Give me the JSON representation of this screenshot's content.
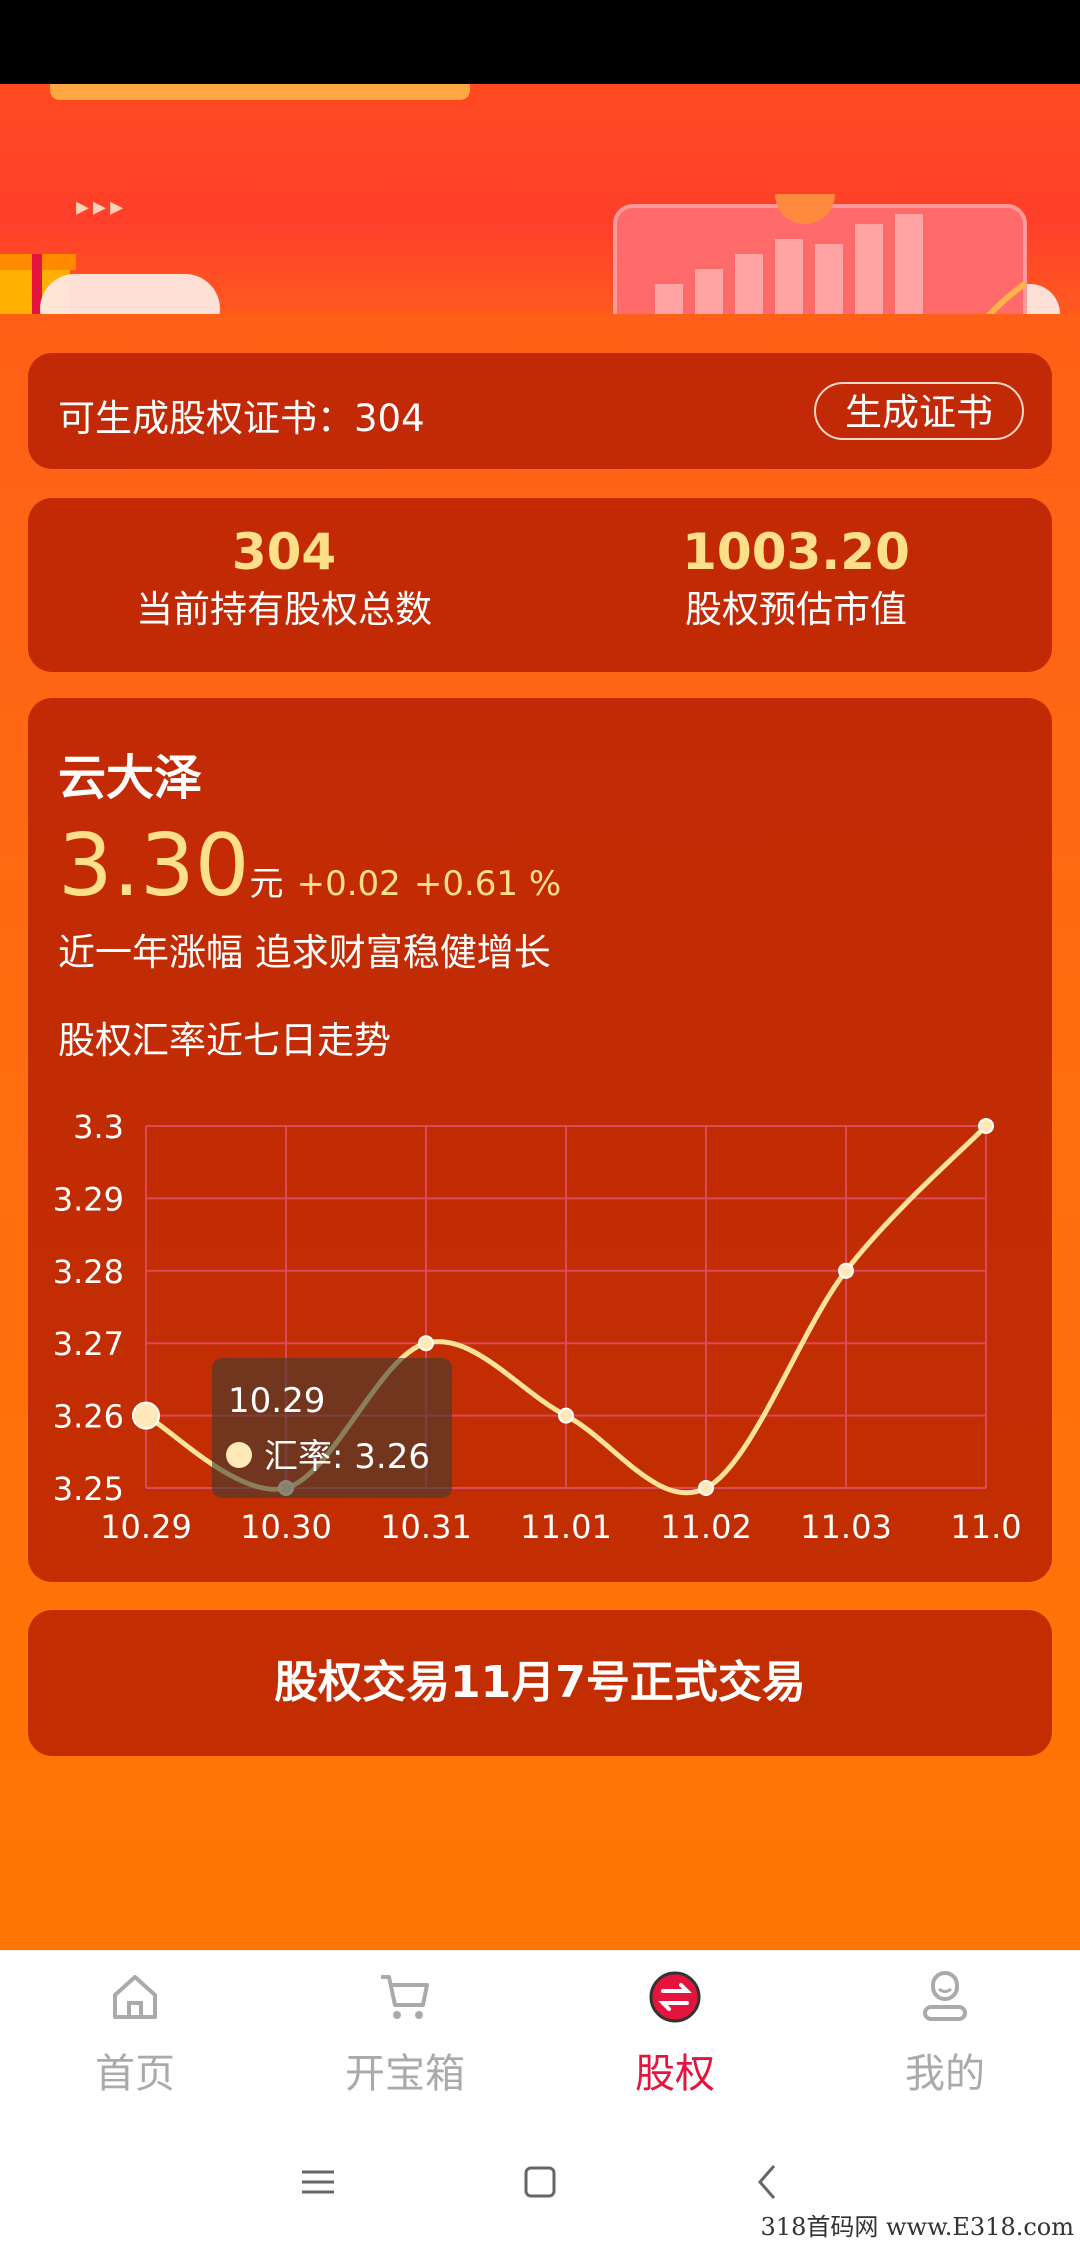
{
  "hero": {
    "decoration_arrows": "▸▸▸"
  },
  "certificate": {
    "label": "可生成股权证书：304",
    "button_label": "生成证书"
  },
  "stats": [
    {
      "value": "304",
      "label": "当前持有股权总数"
    },
    {
      "value": "1003.20",
      "label": "股权预估市值"
    }
  ],
  "stock": {
    "name": "云大泽",
    "price": "3.30",
    "unit": "元",
    "change": "+0.02",
    "change_pct": "+0.61 %",
    "slogan": "近一年涨幅 追求财富稳健增长",
    "trend_label": "股权汇率近七日走势"
  },
  "chart_data": {
    "type": "line",
    "categories": [
      "10.29",
      "10.30",
      "10.31",
      "11.01",
      "11.02",
      "11.03",
      "11.0"
    ],
    "series": [
      {
        "name": "汇率",
        "values": [
          3.26,
          3.25,
          3.27,
          3.26,
          3.25,
          3.28,
          3.3
        ]
      }
    ],
    "y_ticks": [
      "3.3",
      "3.29",
      "3.28",
      "3.27",
      "3.26",
      "3.25"
    ],
    "ylim": [
      3.25,
      3.3
    ],
    "grid": true,
    "tooltip": {
      "title": "10.29",
      "series_label": "汇率: 3.26"
    },
    "colors": {
      "line": "#ffe29a",
      "grid": "#d94a5a",
      "axis_text": "#ffffff"
    }
  },
  "notice": {
    "text": "股权交易11月7号正式交易"
  },
  "bottom_nav": [
    {
      "label": "首页",
      "icon": "home-icon",
      "active": false
    },
    {
      "label": "开宝箱",
      "icon": "cart-icon",
      "active": false
    },
    {
      "label": "股权",
      "icon": "exchange-icon",
      "active": true
    },
    {
      "label": "我的",
      "icon": "user-icon",
      "active": false
    }
  ],
  "watermark": "318首码网 www.E318.com",
  "colors": {
    "accent": "#e5143c",
    "highlight": "#ffe08a",
    "card": "#aa1400"
  }
}
